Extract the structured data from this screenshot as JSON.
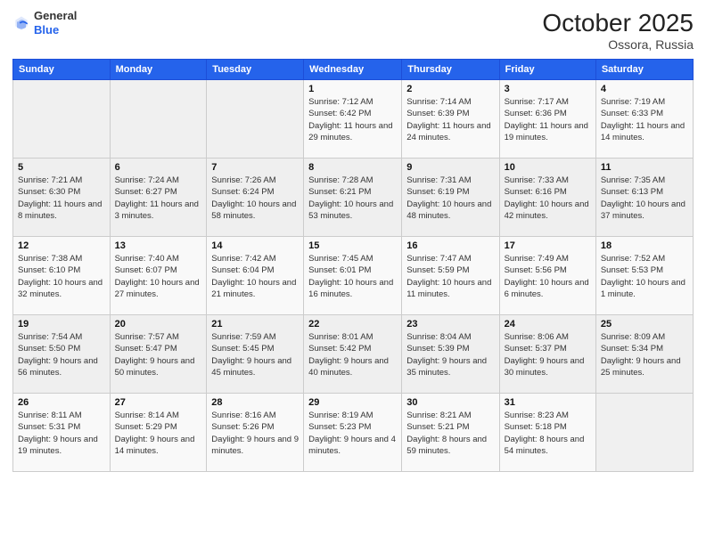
{
  "header": {
    "logo_line1": "General",
    "logo_line2": "Blue",
    "month": "October 2025",
    "location": "Ossora, Russia"
  },
  "weekdays": [
    "Sunday",
    "Monday",
    "Tuesday",
    "Wednesday",
    "Thursday",
    "Friday",
    "Saturday"
  ],
  "weeks": [
    [
      {
        "day": "",
        "sunrise": "",
        "sunset": "",
        "daylight": ""
      },
      {
        "day": "",
        "sunrise": "",
        "sunset": "",
        "daylight": ""
      },
      {
        "day": "",
        "sunrise": "",
        "sunset": "",
        "daylight": ""
      },
      {
        "day": "1",
        "sunrise": "Sunrise: 7:12 AM",
        "sunset": "Sunset: 6:42 PM",
        "daylight": "Daylight: 11 hours and 29 minutes."
      },
      {
        "day": "2",
        "sunrise": "Sunrise: 7:14 AM",
        "sunset": "Sunset: 6:39 PM",
        "daylight": "Daylight: 11 hours and 24 minutes."
      },
      {
        "day": "3",
        "sunrise": "Sunrise: 7:17 AM",
        "sunset": "Sunset: 6:36 PM",
        "daylight": "Daylight: 11 hours and 19 minutes."
      },
      {
        "day": "4",
        "sunrise": "Sunrise: 7:19 AM",
        "sunset": "Sunset: 6:33 PM",
        "daylight": "Daylight: 11 hours and 14 minutes."
      }
    ],
    [
      {
        "day": "5",
        "sunrise": "Sunrise: 7:21 AM",
        "sunset": "Sunset: 6:30 PM",
        "daylight": "Daylight: 11 hours and 8 minutes."
      },
      {
        "day": "6",
        "sunrise": "Sunrise: 7:24 AM",
        "sunset": "Sunset: 6:27 PM",
        "daylight": "Daylight: 11 hours and 3 minutes."
      },
      {
        "day": "7",
        "sunrise": "Sunrise: 7:26 AM",
        "sunset": "Sunset: 6:24 PM",
        "daylight": "Daylight: 10 hours and 58 minutes."
      },
      {
        "day": "8",
        "sunrise": "Sunrise: 7:28 AM",
        "sunset": "Sunset: 6:21 PM",
        "daylight": "Daylight: 10 hours and 53 minutes."
      },
      {
        "day": "9",
        "sunrise": "Sunrise: 7:31 AM",
        "sunset": "Sunset: 6:19 PM",
        "daylight": "Daylight: 10 hours and 48 minutes."
      },
      {
        "day": "10",
        "sunrise": "Sunrise: 7:33 AM",
        "sunset": "Sunset: 6:16 PM",
        "daylight": "Daylight: 10 hours and 42 minutes."
      },
      {
        "day": "11",
        "sunrise": "Sunrise: 7:35 AM",
        "sunset": "Sunset: 6:13 PM",
        "daylight": "Daylight: 10 hours and 37 minutes."
      }
    ],
    [
      {
        "day": "12",
        "sunrise": "Sunrise: 7:38 AM",
        "sunset": "Sunset: 6:10 PM",
        "daylight": "Daylight: 10 hours and 32 minutes."
      },
      {
        "day": "13",
        "sunrise": "Sunrise: 7:40 AM",
        "sunset": "Sunset: 6:07 PM",
        "daylight": "Daylight: 10 hours and 27 minutes."
      },
      {
        "day": "14",
        "sunrise": "Sunrise: 7:42 AM",
        "sunset": "Sunset: 6:04 PM",
        "daylight": "Daylight: 10 hours and 21 minutes."
      },
      {
        "day": "15",
        "sunrise": "Sunrise: 7:45 AM",
        "sunset": "Sunset: 6:01 PM",
        "daylight": "Daylight: 10 hours and 16 minutes."
      },
      {
        "day": "16",
        "sunrise": "Sunrise: 7:47 AM",
        "sunset": "Sunset: 5:59 PM",
        "daylight": "Daylight: 10 hours and 11 minutes."
      },
      {
        "day": "17",
        "sunrise": "Sunrise: 7:49 AM",
        "sunset": "Sunset: 5:56 PM",
        "daylight": "Daylight: 10 hours and 6 minutes."
      },
      {
        "day": "18",
        "sunrise": "Sunrise: 7:52 AM",
        "sunset": "Sunset: 5:53 PM",
        "daylight": "Daylight: 10 hours and 1 minute."
      }
    ],
    [
      {
        "day": "19",
        "sunrise": "Sunrise: 7:54 AM",
        "sunset": "Sunset: 5:50 PM",
        "daylight": "Daylight: 9 hours and 56 minutes."
      },
      {
        "day": "20",
        "sunrise": "Sunrise: 7:57 AM",
        "sunset": "Sunset: 5:47 PM",
        "daylight": "Daylight: 9 hours and 50 minutes."
      },
      {
        "day": "21",
        "sunrise": "Sunrise: 7:59 AM",
        "sunset": "Sunset: 5:45 PM",
        "daylight": "Daylight: 9 hours and 45 minutes."
      },
      {
        "day": "22",
        "sunrise": "Sunrise: 8:01 AM",
        "sunset": "Sunset: 5:42 PM",
        "daylight": "Daylight: 9 hours and 40 minutes."
      },
      {
        "day": "23",
        "sunrise": "Sunrise: 8:04 AM",
        "sunset": "Sunset: 5:39 PM",
        "daylight": "Daylight: 9 hours and 35 minutes."
      },
      {
        "day": "24",
        "sunrise": "Sunrise: 8:06 AM",
        "sunset": "Sunset: 5:37 PM",
        "daylight": "Daylight: 9 hours and 30 minutes."
      },
      {
        "day": "25",
        "sunrise": "Sunrise: 8:09 AM",
        "sunset": "Sunset: 5:34 PM",
        "daylight": "Daylight: 9 hours and 25 minutes."
      }
    ],
    [
      {
        "day": "26",
        "sunrise": "Sunrise: 8:11 AM",
        "sunset": "Sunset: 5:31 PM",
        "daylight": "Daylight: 9 hours and 19 minutes."
      },
      {
        "day": "27",
        "sunrise": "Sunrise: 8:14 AM",
        "sunset": "Sunset: 5:29 PM",
        "daylight": "Daylight: 9 hours and 14 minutes."
      },
      {
        "day": "28",
        "sunrise": "Sunrise: 8:16 AM",
        "sunset": "Sunset: 5:26 PM",
        "daylight": "Daylight: 9 hours and 9 minutes."
      },
      {
        "day": "29",
        "sunrise": "Sunrise: 8:19 AM",
        "sunset": "Sunset: 5:23 PM",
        "daylight": "Daylight: 9 hours and 4 minutes."
      },
      {
        "day": "30",
        "sunrise": "Sunrise: 8:21 AM",
        "sunset": "Sunset: 5:21 PM",
        "daylight": "Daylight: 8 hours and 59 minutes."
      },
      {
        "day": "31",
        "sunrise": "Sunrise: 8:23 AM",
        "sunset": "Sunset: 5:18 PM",
        "daylight": "Daylight: 8 hours and 54 minutes."
      },
      {
        "day": "",
        "sunrise": "",
        "sunset": "",
        "daylight": ""
      }
    ]
  ]
}
